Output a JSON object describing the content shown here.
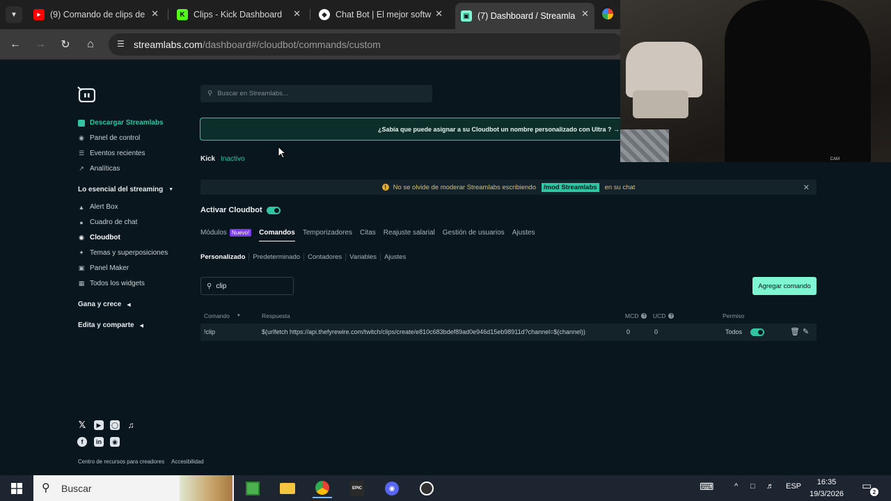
{
  "browser": {
    "tabs": [
      {
        "title": "(9) Comando de clips de",
        "color": "#ff0000",
        "glyph": "▶",
        "close": "✕"
      },
      {
        "title": "Clips - Kick Dashboard",
        "color": "#53fc18",
        "glyph": "K",
        "close": "✕"
      },
      {
        "title": "Chat Bot | El mejor softw",
        "color": "#2b2b2b",
        "glyph": "◆",
        "close": "✕"
      },
      {
        "title": "(7) Dashboard / Streamla",
        "color": "#80f5d2",
        "glyph": "▣",
        "close": "✕"
      }
    ],
    "url_host": "streamlabs.com",
    "url_path": "/dashboard#/cloudbot/commands/custom"
  },
  "search": {
    "placeholder": "Buscar en Streamlabs..."
  },
  "sidebar": {
    "items_top": [
      {
        "label": "Descargar Streamlabs",
        "icon": "download-icon"
      },
      {
        "label": "Panel de control",
        "icon": "dashboard-icon"
      },
      {
        "label": "Eventos recientes",
        "icon": "list-icon"
      },
      {
        "label": "Analíticas",
        "icon": "chart-icon"
      }
    ],
    "section1": "Lo esencial del streaming",
    "items_essentials": [
      {
        "label": "Alert Box",
        "icon": "alert-icon"
      },
      {
        "label": "Cuadro de chat",
        "icon": "chat-icon"
      },
      {
        "label": "Cloudbot",
        "icon": "cloudbot-icon"
      },
      {
        "label": "Temas y superposiciones",
        "icon": "themes-icon"
      },
      {
        "label": "Panel Maker",
        "icon": "panel-icon"
      },
      {
        "label": "Todos los widgets",
        "icon": "widgets-icon"
      }
    ],
    "section2": "Gana y crece",
    "section3": "Edita y comparte"
  },
  "promo": {
    "text": "¿Sabía que puede asignar a su Cloudbot un nombre personalizado con Ultra ? →"
  },
  "kick": {
    "label": "Kick",
    "status": "Inactivo"
  },
  "notice": {
    "before": "No se olvide de moderar Streamlabs escribiendo",
    "tag": "/mod Streamlabs",
    "after": "en su chat"
  },
  "cloudbot": {
    "activar": "Activar Cloudbot"
  },
  "tabs": {
    "modulos": "Módulos",
    "nuevo": "Nuevo!",
    "comandos": "Comandos",
    "temporizadores": "Temporizadores",
    "citas": "Citas",
    "reajuste": "Reajuste salarial",
    "gestion": "Gestión de usuarios",
    "ajustes": "Ajustes"
  },
  "subtabs": [
    "Personalizado",
    "Predeterminado",
    "Contadores",
    "Variables",
    "Ajustes"
  ],
  "command_search": {
    "value": "clip"
  },
  "add_button": "Agregar comando",
  "table": {
    "headers": {
      "comando": "Comando",
      "respuesta": "Respuesta",
      "mcd": "MCD",
      "ucd": "UCD",
      "permiso": "Permiso"
    },
    "rows": [
      {
        "comando": "!clip",
        "respuesta": "$(urlfetch https://api.thefyrewire.com/twitch/clips/create/e810c683bdef89ad0e946d15eb98911d?channel=$(channel))",
        "mcd": "0",
        "ucd": "0",
        "permiso": "Todos"
      }
    ]
  },
  "footer": {
    "recursos": "Centro de recursos para creadores",
    "accesibilidad": "Accesibilidad"
  },
  "webcam": {
    "label": "CAM"
  },
  "taskbar": {
    "search_placeholder": "Buscar",
    "lang": "ESP",
    "time": "16:35",
    "date": "19/3/2026",
    "notif_count": "2"
  },
  "colors": {
    "accent": "#31c3a2",
    "button": "#80f5d2",
    "background": "#09161d"
  }
}
